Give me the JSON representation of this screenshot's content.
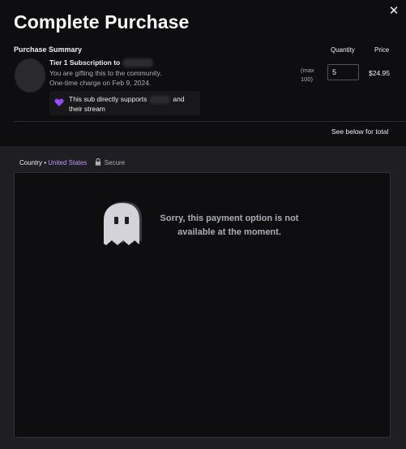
{
  "header": {
    "title": "Complete Purchase",
    "close_icon": "close-icon"
  },
  "summary": {
    "label": "Purchase Summary",
    "quantity_label": "Quantity",
    "price_label": "Price",
    "item": {
      "title_prefix": "Tier 1 Subscription to",
      "line1": "You are gifting this to the community.",
      "line2": "One-time charge on Feb 9, 2024.",
      "support_prefix": "This sub directly supports",
      "support_suffix": "and their stream",
      "support_icon": "purple-heart-icon",
      "max_note_1": "(max",
      "max_note_2": "100)",
      "quantity_value": "5",
      "price": "$24.95"
    },
    "see_below": "See below for total"
  },
  "payment": {
    "country_label": "Country •",
    "country_value": "United States",
    "secure_label": "Secure",
    "secure_icon": "lock-icon",
    "message": "Sorry, this payment option is not available at the moment.",
    "ghost_icon": "ghost-icon"
  },
  "colors": {
    "accent": "#bf94ff",
    "background": "#0e0e10",
    "panel": "#1f1f23",
    "heart": "#9147ff"
  }
}
